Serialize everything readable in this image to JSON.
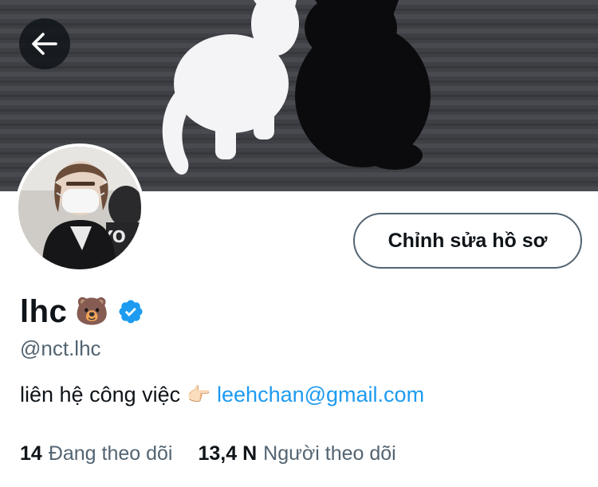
{
  "header": {
    "back_icon": "arrow-left-icon",
    "banner_description_icon": "cats-banner-image"
  },
  "profile": {
    "display_name": "lhc",
    "name_emoji": "🐻",
    "verified_icon": "verified-badge-icon",
    "handle": "@nct.lhc",
    "edit_button_label": "Chỉnh sửa hồ sơ",
    "bio_text": "liên hệ công việc",
    "bio_emoji": "👉🏻",
    "bio_link": "leehchan@gmail.com"
  },
  "stats": {
    "following_count": "14",
    "following_label": "Đang theo dõi",
    "followers_count": "13,4 N",
    "followers_label": "Người theo dõi"
  },
  "colors": {
    "accent": "#1d9bf0",
    "text_primary": "#0f1419",
    "text_secondary": "#536471",
    "button_border": "#536471"
  }
}
